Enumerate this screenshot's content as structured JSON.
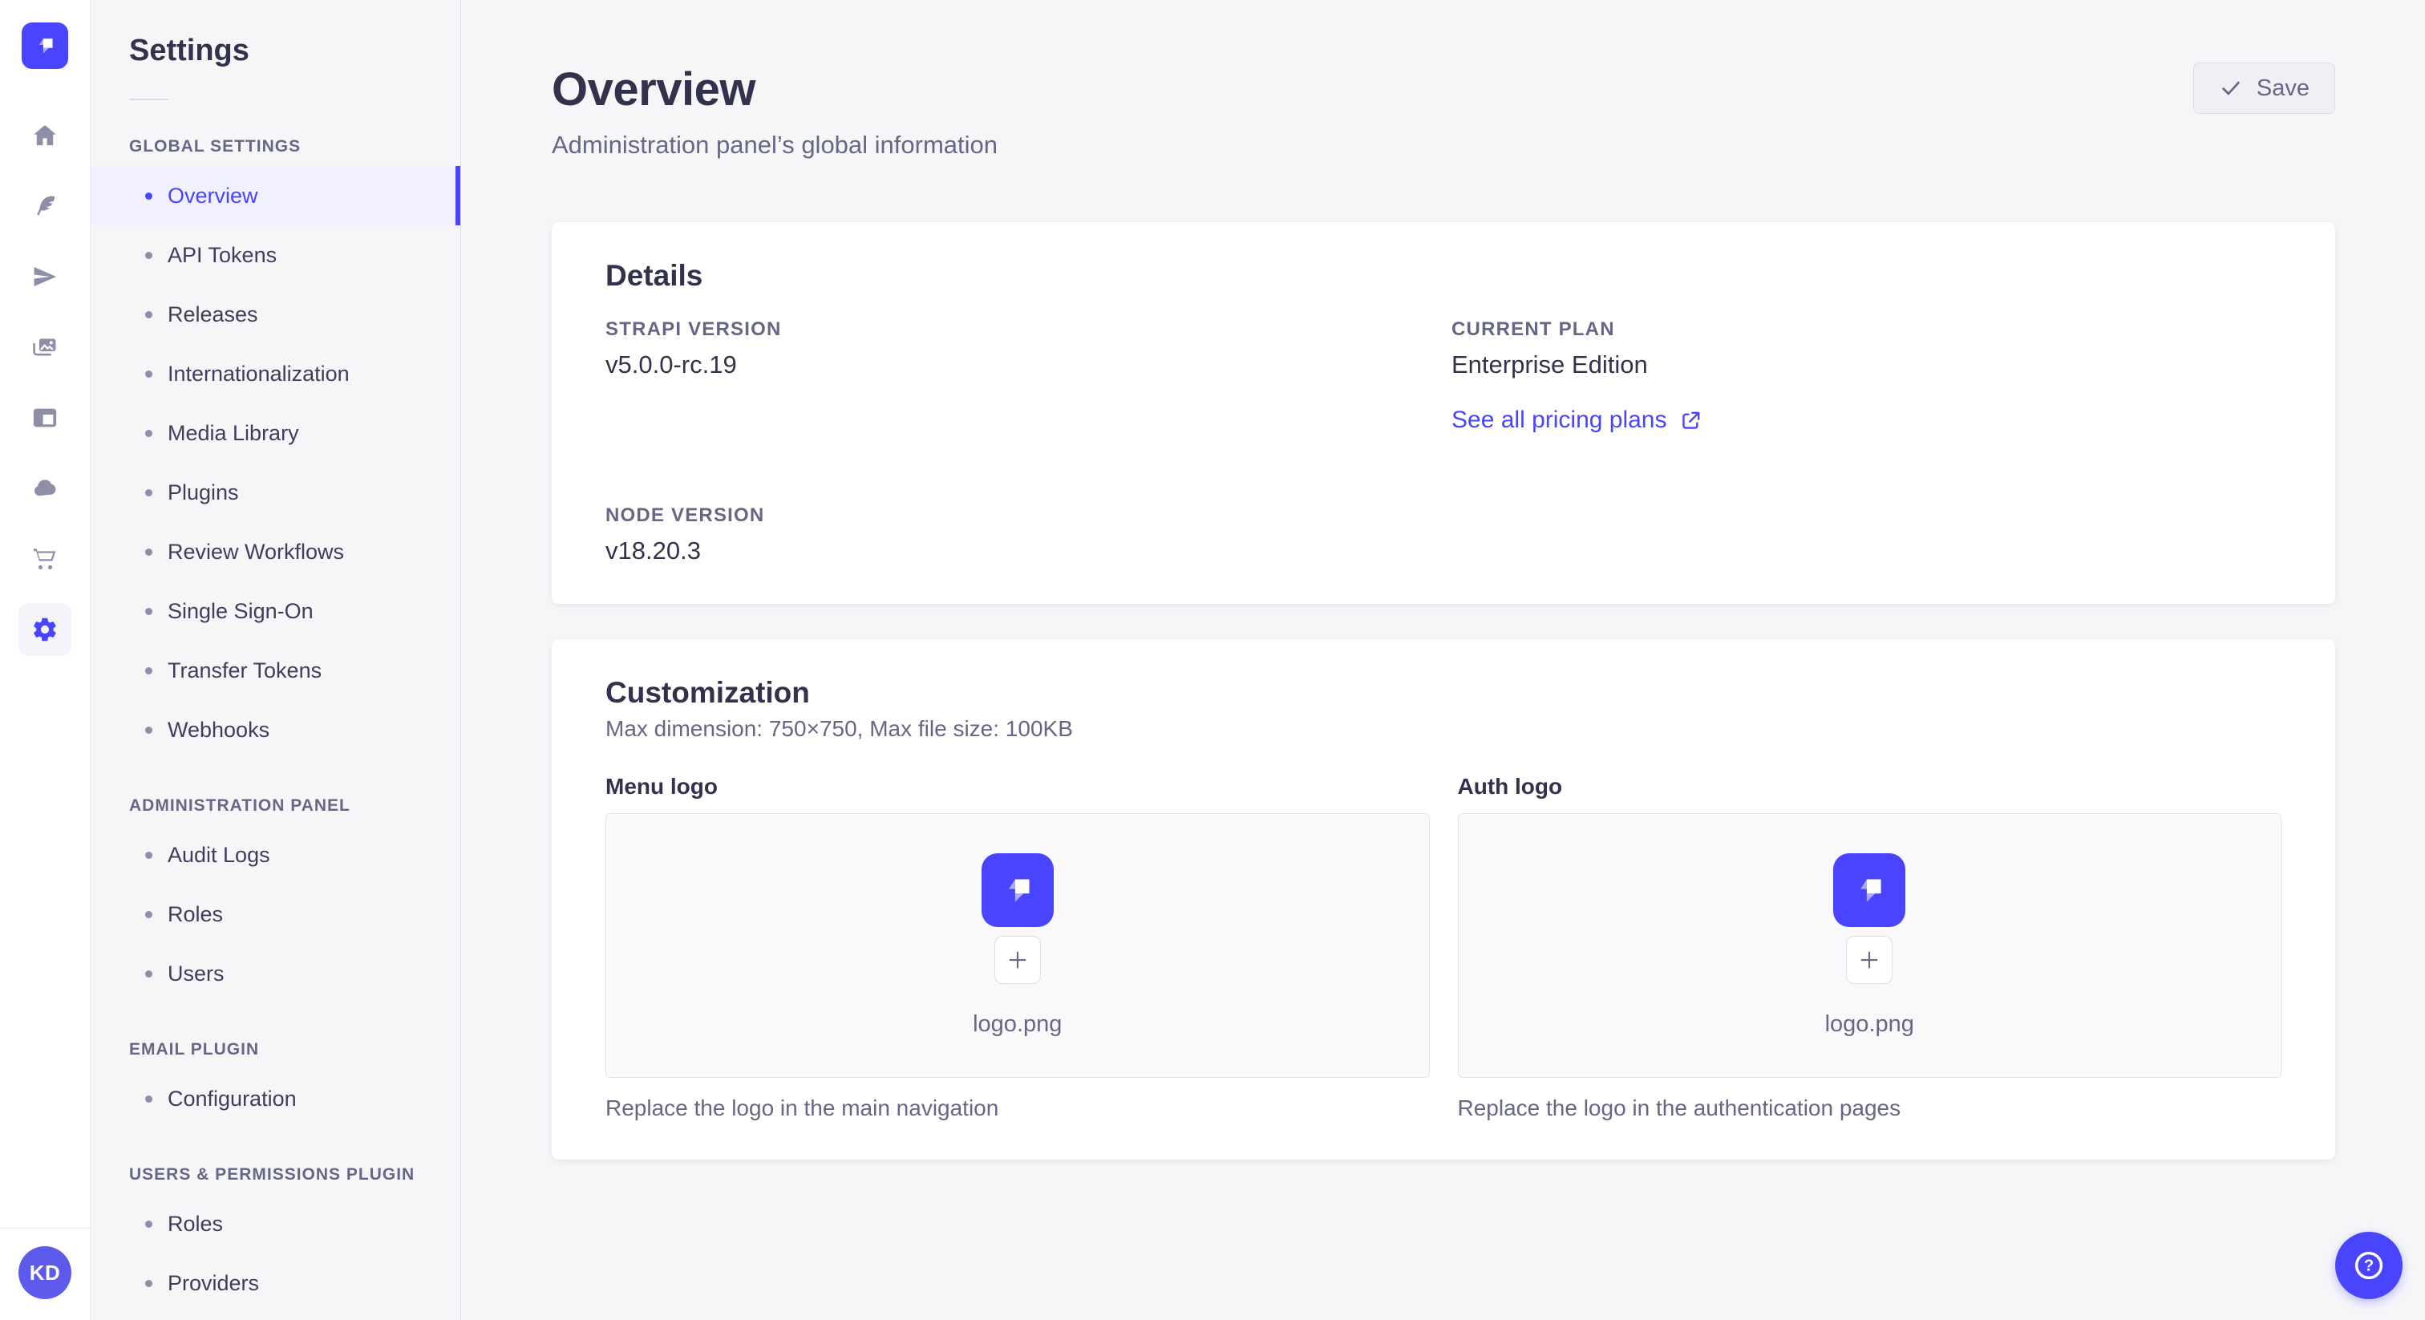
{
  "colors": {
    "primary": "#4945ff",
    "primary_light": "#f0f0ff",
    "page_bg": "#f6f6f9",
    "text_dark": "#32324d",
    "text_grey": "#666687"
  },
  "nav_rail": {
    "icons": [
      "strapi-logo",
      "home",
      "feather",
      "paper-plane",
      "images",
      "layout",
      "cloud",
      "cart",
      "gear"
    ],
    "active_icon": "gear",
    "avatar_initials": "KD"
  },
  "sidebar": {
    "title": "Settings",
    "sections": [
      {
        "label": "GLOBAL SETTINGS",
        "items": [
          {
            "label": "Overview",
            "active": true
          },
          {
            "label": "API Tokens"
          },
          {
            "label": "Releases"
          },
          {
            "label": "Internationalization"
          },
          {
            "label": "Media Library"
          },
          {
            "label": "Plugins"
          },
          {
            "label": "Review Workflows"
          },
          {
            "label": "Single Sign-On"
          },
          {
            "label": "Transfer Tokens"
          },
          {
            "label": "Webhooks"
          }
        ]
      },
      {
        "label": "ADMINISTRATION PANEL",
        "items": [
          {
            "label": "Audit Logs"
          },
          {
            "label": "Roles"
          },
          {
            "label": "Users"
          }
        ]
      },
      {
        "label": "EMAIL PLUGIN",
        "items": [
          {
            "label": "Configuration"
          }
        ]
      },
      {
        "label": "USERS & PERMISSIONS PLUGIN",
        "items": [
          {
            "label": "Roles"
          },
          {
            "label": "Providers"
          }
        ]
      }
    ]
  },
  "header": {
    "title": "Overview",
    "subtitle": "Administration panel’s global information",
    "save_label": "Save"
  },
  "details_card": {
    "title": "Details",
    "strapi_version": {
      "label": "STRAPI VERSION",
      "value": "v5.0.0-rc.19"
    },
    "current_plan": {
      "label": "CURRENT PLAN",
      "value": "Enterprise Edition"
    },
    "node_version": {
      "label": "NODE VERSION",
      "value": "v18.20.3"
    },
    "pricing_link_label": "See all pricing plans"
  },
  "customization_card": {
    "title": "Customization",
    "subtitle": "Max dimension: 750×750, Max file size: 100KB",
    "menu_logo": {
      "label": "Menu logo",
      "filename": "logo.png",
      "caption": "Replace the logo in the main navigation"
    },
    "auth_logo": {
      "label": "Auth logo",
      "filename": "logo.png",
      "caption": "Replace the logo in the authentication pages"
    }
  },
  "help": {
    "glyph": "?"
  }
}
